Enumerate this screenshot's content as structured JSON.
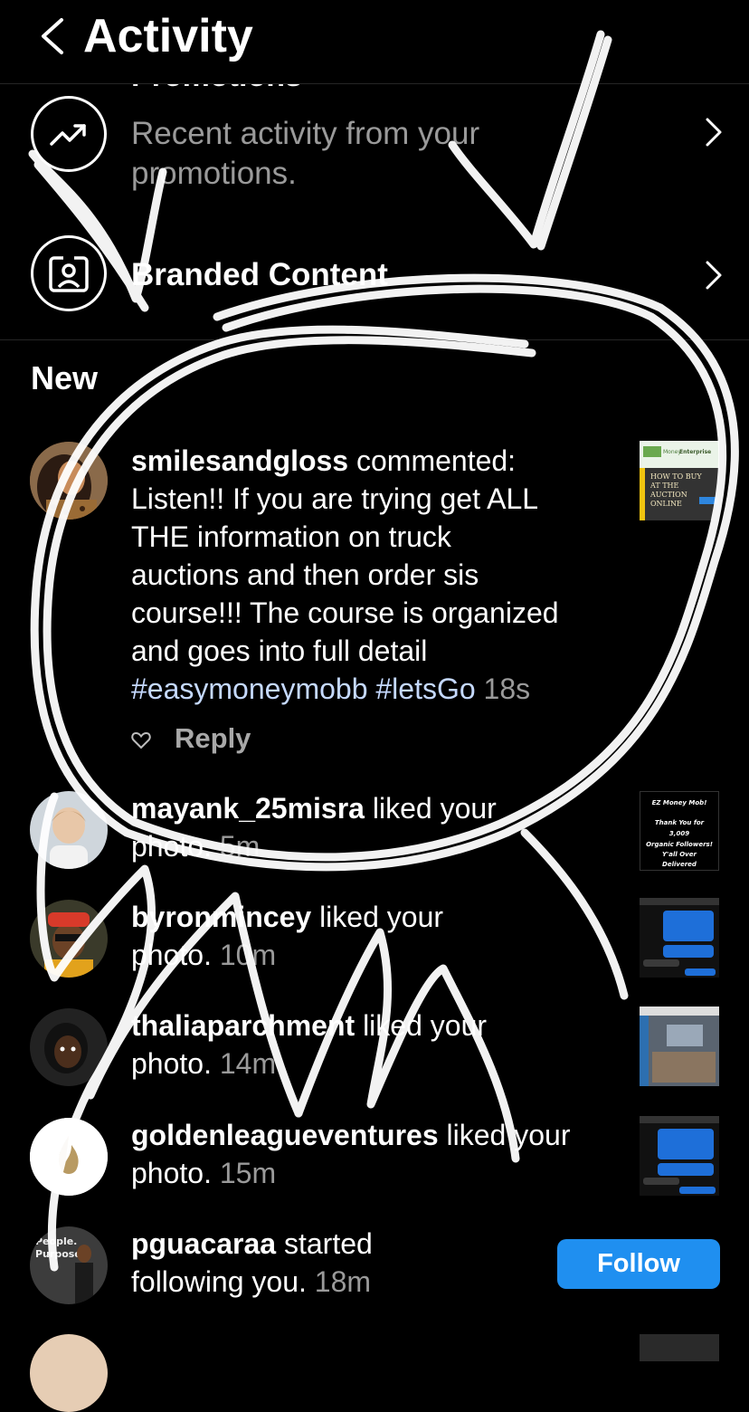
{
  "header": {
    "title": "Activity",
    "back_icon": "chevron-left-icon"
  },
  "promotions": {
    "title_partial": "Promotions",
    "subtitle_line1": "Recent activity from your",
    "subtitle_line2": "promotions.",
    "icon": "trending-up-icon"
  },
  "branded_content": {
    "title": "Branded Content",
    "icon": "id-badge-icon"
  },
  "section_new": "New",
  "comment": {
    "username": "smilesandgloss",
    "action": " commented:",
    "lines": [
      "Listen!! If you are trying get ALL",
      "THE information on truck",
      "auctions and then order sis",
      "course!!! The course is organized",
      "and goes into full detail"
    ],
    "tag1": "#easymoneymobb",
    "tag2": "#letsGo",
    "time": "18s",
    "reply": "Reply",
    "thumb_text": {
      "brand1": "Money",
      "brand2": "Enterprise",
      "line1": "HOW TO BUY",
      "line2": "AT THE",
      "line3": "AUCTION",
      "line4": "ONLINE"
    }
  },
  "likes": [
    {
      "username": "mayank_25misra",
      "action": " liked your",
      "line2": "photo.",
      "time": "5m"
    },
    {
      "username": "byronmincey",
      "action": " liked your",
      "line2": "photo.",
      "time": "10m"
    },
    {
      "username": "thaliaparchment",
      "action": " liked your",
      "line2": "photo.",
      "time": "14m"
    },
    {
      "username": "goldenleagueventures",
      "action": " liked your",
      "line2": "photo.",
      "time": "15m"
    }
  ],
  "thumb_mob": {
    "l1": "EZ Money Mob!",
    "l2": "Thank You for",
    "l3": "3,009",
    "l4": "Organic Followers!",
    "l5": "Y'all Over",
    "l6": "Delivered"
  },
  "follow_notif": {
    "username": "pguacaraa",
    "action": " started",
    "line2": "following you.",
    "time": "18m",
    "button": "Follow",
    "avatar_text1": "People.",
    "avatar_text2": "Purpose"
  },
  "colors": {
    "accent": "#1f8ff0",
    "background": "#000000",
    "secondary_text": "#9a9a9a"
  }
}
